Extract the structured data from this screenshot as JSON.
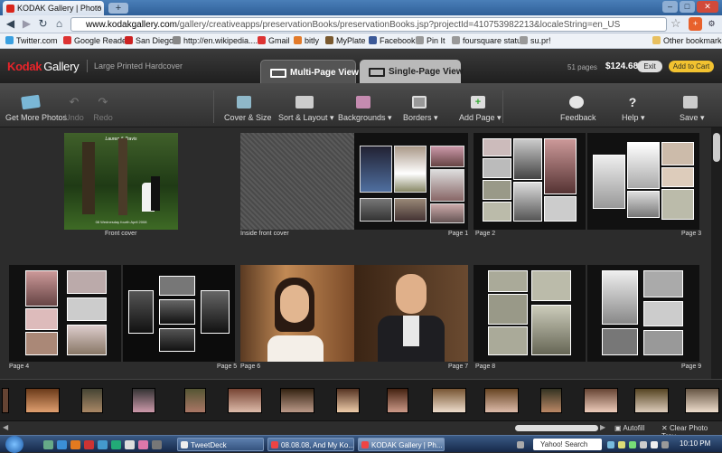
{
  "browser": {
    "tab_title": "KODAK Gallery | Photo Boo",
    "new_tab": "+",
    "url_domain": "www.kodakgallery.com",
    "url_path": "/gallery/creativeapps/preservationBooks/preservationBooks.jsp?projectId=410753982213&localeString=en_US",
    "bookmarks": [
      "Twitter.com",
      "Google Reader",
      "San Diego",
      "http://en.wikipedia....",
      "Gmail",
      "bitly",
      "MyPlate",
      "Facebook",
      "Pin It",
      "foursquare status",
      "su.pr!"
    ],
    "other_bookmarks": "Other bookmarks"
  },
  "app": {
    "brand": "Kodak",
    "brand_sub": "Gallery",
    "product": "Large Printed Hardcover",
    "tab_multi": "Multi-Page View",
    "tab_single": "Single-Page View",
    "pages": "51 pages",
    "price": "$124.68",
    "exit": "Exit",
    "add_to_cart": "Add to Cart"
  },
  "ribbon": {
    "get_more": "Get More Photos",
    "undo": "Undo",
    "redo": "Redo",
    "cover_size": "Cover & Size",
    "sort_layout": "Sort & Layout",
    "backgrounds": "Backgrounds",
    "borders": "Borders",
    "add_page": "Add Page",
    "feedback": "Feedback",
    "help": "Help",
    "save": "Save"
  },
  "cover_text": {
    "names": "Lauren & Travis",
    "date": "08 Wednesday fourth April 2008"
  },
  "labels": {
    "front_cover": "Front cover",
    "inside_front": "Inside front cover",
    "p1": "Page 1",
    "p2": "Page 2",
    "p3": "Page 3",
    "p4": "Page 4",
    "p5": "Page 5",
    "p6": "Page 6",
    "p7": "Page 7",
    "p8": "Page 8",
    "p9": "Page 9"
  },
  "bottom": {
    "autofill": "Autofill",
    "clear_tray": "Clear Photo Tray"
  },
  "taskbar": {
    "items": [
      "TweetDeck",
      "08.08.08, And My Ko...",
      "KODAK Gallery | Ph..."
    ],
    "search": "Yahoo! Search",
    "clock": "10:10 PM"
  },
  "colors": {
    "kodak_red": "#e8242a",
    "cart_yellow": "#f2c230"
  }
}
